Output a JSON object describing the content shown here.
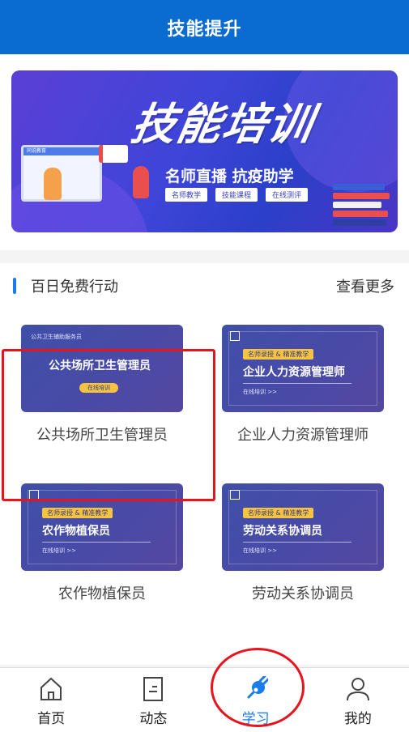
{
  "header": {
    "title": "技能提升"
  },
  "banner": {
    "title": "技能培训",
    "subtitle": "名师直播 抗疫助学",
    "tags": [
      "名师教学",
      "技能课程",
      "在线测评"
    ],
    "logo_text": "同说教育"
  },
  "section": {
    "title": "百日免费行动",
    "more": "查看更多",
    "cards": [
      {
        "label": "公共场所卫生管理员",
        "thumb_title": "公共场所卫生管理员",
        "thumb_top": "公共卫生辅助服务员",
        "thumb_btn": "在线培训",
        "highlighted": true
      },
      {
        "label": "企业人力资源管理师",
        "thumb_title": "企业人力资源管理师",
        "thumb_tag": "名师录授 & 精准教学",
        "thumb_small": "在线培训 >>"
      },
      {
        "label": "农作物植保员",
        "thumb_title": "农作物植保员",
        "thumb_tag": "名师录授 & 精准教学",
        "thumb_small": "在线培训 >>"
      },
      {
        "label": "劳动关系协调员",
        "thumb_title": "劳动关系协调员",
        "thumb_tag": "名师录授 & 精准教学",
        "thumb_small": "在线培训 >>"
      }
    ]
  },
  "tabbar": {
    "items": [
      {
        "label": "首页",
        "icon": "home-icon"
      },
      {
        "label": "动态",
        "icon": "news-icon"
      },
      {
        "label": "学习",
        "icon": "study-icon",
        "active": true
      },
      {
        "label": "我的",
        "icon": "profile-icon"
      }
    ]
  },
  "colors": {
    "header": "#0a6bd0",
    "accent": "#1a7ce9",
    "annotation": "#e8141c"
  }
}
